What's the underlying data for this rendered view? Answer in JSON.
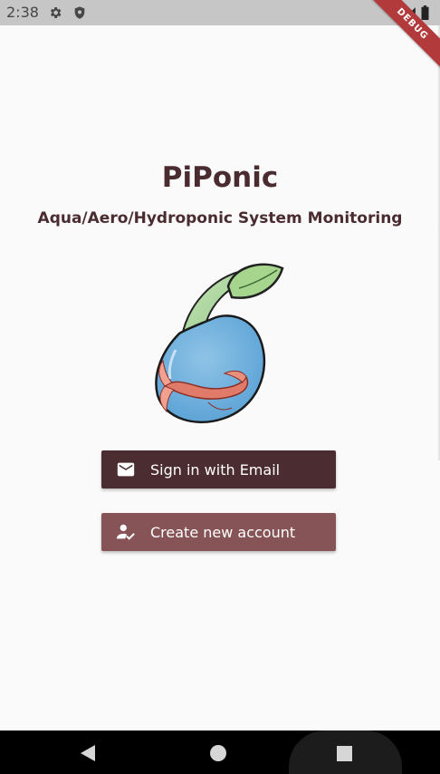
{
  "status_bar": {
    "time": "2:38",
    "icons": [
      "gear-icon",
      "shield-icon",
      "wifi-icon",
      "signal-icon",
      "battery-icon"
    ]
  },
  "debug_banner": "DEBUG",
  "app": {
    "title": "PiPonic",
    "subtitle": "Aqua/Aero/Hydroponic System Monitoring"
  },
  "buttons": {
    "sign_in": {
      "label": "Sign in with Email",
      "icon": "mail-icon",
      "color": "#4b2d31"
    },
    "create": {
      "label": "Create new account",
      "icon": "person-check-icon",
      "color": "#865456"
    }
  },
  "nav": {
    "icons": [
      "back-icon",
      "home-icon",
      "recents-icon"
    ]
  },
  "colors": {
    "title": "#4a2c30",
    "background": "#fafafa"
  }
}
